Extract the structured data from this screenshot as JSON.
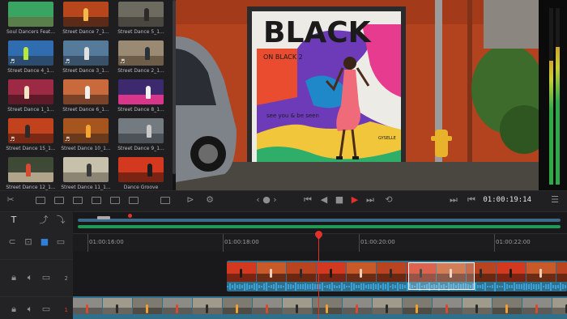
{
  "media_pool": {
    "clips": [
      {
        "name": "Soul Dancers Feat...",
        "sky": "#3aa563",
        "ground": "#5a7f4a",
        "fig": null,
        "note": "",
        "row": 0,
        "col": 0
      },
      {
        "name": "Street Dance 7_1...",
        "sky": "#b8461c",
        "ground": "#5c2b17",
        "fig": "#f2b84a",
        "note": "",
        "row": 0,
        "col": 1
      },
      {
        "name": "Street Dance 5_1...",
        "sky": "#6d6a60",
        "ground": "#4a4741",
        "fig": "#2c2b2a",
        "note": "",
        "row": 0,
        "col": 2
      },
      {
        "name": "Street Dance 4_1...",
        "sky": "#2f6db0",
        "ground": "#2b4c6e",
        "fig": "#b8e83a",
        "note": "♬",
        "row": 1,
        "col": 0
      },
      {
        "name": "Street Dance 3_1...",
        "sky": "#567a9a",
        "ground": "#39526a",
        "fig": "#e0e0e0",
        "note": "♬",
        "row": 1,
        "col": 1
      },
      {
        "name": "Street Dance 2_1...",
        "sky": "#9a8a74",
        "ground": "#6c5c48",
        "fig": "#2a3138",
        "note": "♬",
        "row": 1,
        "col": 2
      },
      {
        "name": "Street Dance 1_1...",
        "sky": "#9d2a45",
        "ground": "#5f1a2a",
        "fig": "#f5e2c2",
        "note": "",
        "row": 2,
        "col": 0
      },
      {
        "name": "Street Dance 6_1...",
        "sky": "#c86a3c",
        "ground": "#7a4228",
        "fig": "#f0f0f0",
        "note": "",
        "row": 2,
        "col": 1
      },
      {
        "name": "Street Dance 8_1...",
        "sky": "#3d2a6e",
        "ground": "#d8368a",
        "fig": "#f2f2f2",
        "note": "",
        "row": 2,
        "col": 2
      },
      {
        "name": "Street Dance 15_1...",
        "sky": "#c1421d",
        "ground": "#7a2a14",
        "fig": "#2b2b2b",
        "note": "♬",
        "row": 3,
        "col": 0
      },
      {
        "name": "Street Dance 10_1...",
        "sky": "#a7551f",
        "ground": "#6b3a1c",
        "fig": "#f4a531",
        "note": "♬",
        "row": 3,
        "col": 1
      },
      {
        "name": "Street Dance 9_1...",
        "sky": "#737b80",
        "ground": "#4c5257",
        "fig": "#c9c9c9",
        "note": "",
        "row": 3,
        "col": 2
      },
      {
        "name": "Street Dance 12_1...",
        "sky": "#3f4a36",
        "ground": "#b0a48a",
        "fig": "#d64b30",
        "note": "",
        "row": 4,
        "col": 0
      },
      {
        "name": "Street Dance 11_1...",
        "sky": "#c7c0ab",
        "ground": "#8c8574",
        "fig": "#3a3a3a",
        "note": "",
        "row": 4,
        "col": 1
      },
      {
        "name": "Dance Groove",
        "sky": "#d2391e",
        "ground": "#7c2413",
        "fig": "#1c1c1c",
        "note": "",
        "row": 4,
        "col": 2
      }
    ]
  },
  "viewer": {
    "sign_text": "BLACK",
    "sign_sub": "ON BLACK 2",
    "mural_sub": "see you & be seen",
    "tag": "GYSELLE"
  },
  "toolbar": {
    "timecode": "01:00:19:14",
    "transport_icons": [
      "first-frame-icon",
      "step-back-icon",
      "stop-icon",
      "play-icon",
      "step-forward-icon",
      "loop-icon"
    ]
  },
  "timeline": {
    "ruler_labels": [
      "01:00:16:00",
      "01:00:18:00",
      "01:00:20:00",
      "01:00:22:00"
    ],
    "track_numbers": [
      "2",
      "1"
    ],
    "playhead_timecode": "01:00:19:14",
    "colors": {
      "video_track": "#2f6f8a",
      "audio_wave": "#3aa0d8",
      "playhead": "#e0312b",
      "accent": "#e0312b"
    }
  }
}
